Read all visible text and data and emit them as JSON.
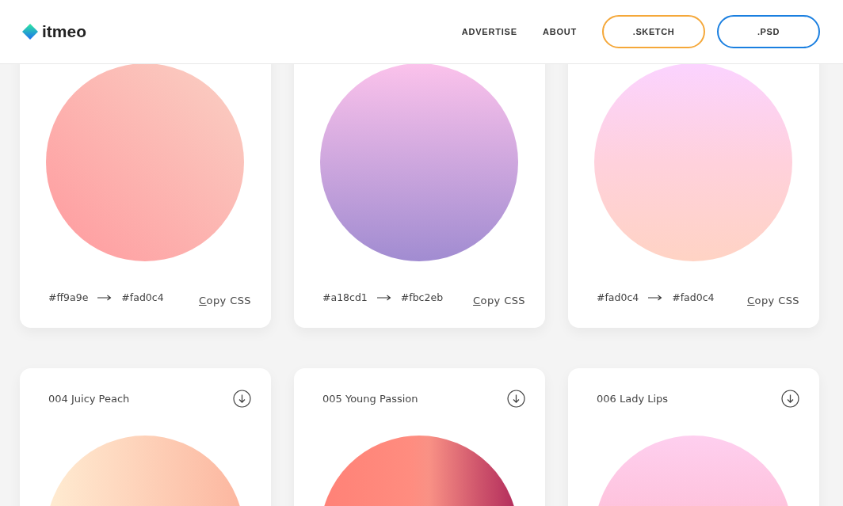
{
  "header": {
    "logo": "itmeo",
    "nav": [
      {
        "label": "ADVERTISE"
      },
      {
        "label": "ABOUT"
      }
    ],
    "buttons": [
      {
        "label": ".SKETCH",
        "kind": "sketch"
      },
      {
        "label": ".PSD",
        "kind": "psd"
      }
    ]
  },
  "cards": [
    {
      "kind": "diagonal",
      "from": "#ff9a9e",
      "to": "#fad0c4",
      "action": "Copy CSS"
    },
    {
      "kind": "rising",
      "from": "#a18cd1",
      "to": "#fbc2eb",
      "action": "Copy CSS"
    },
    {
      "kind": "spring",
      "from": "#fad0c4",
      "to": "#fad0c4",
      "action": "Copy CSS"
    },
    {
      "kind": "peach",
      "title": "004 Juicy Peach"
    },
    {
      "kind": "passion",
      "title": "005 Young Passion"
    },
    {
      "kind": "lips",
      "title": "006 Lady Lips"
    }
  ]
}
